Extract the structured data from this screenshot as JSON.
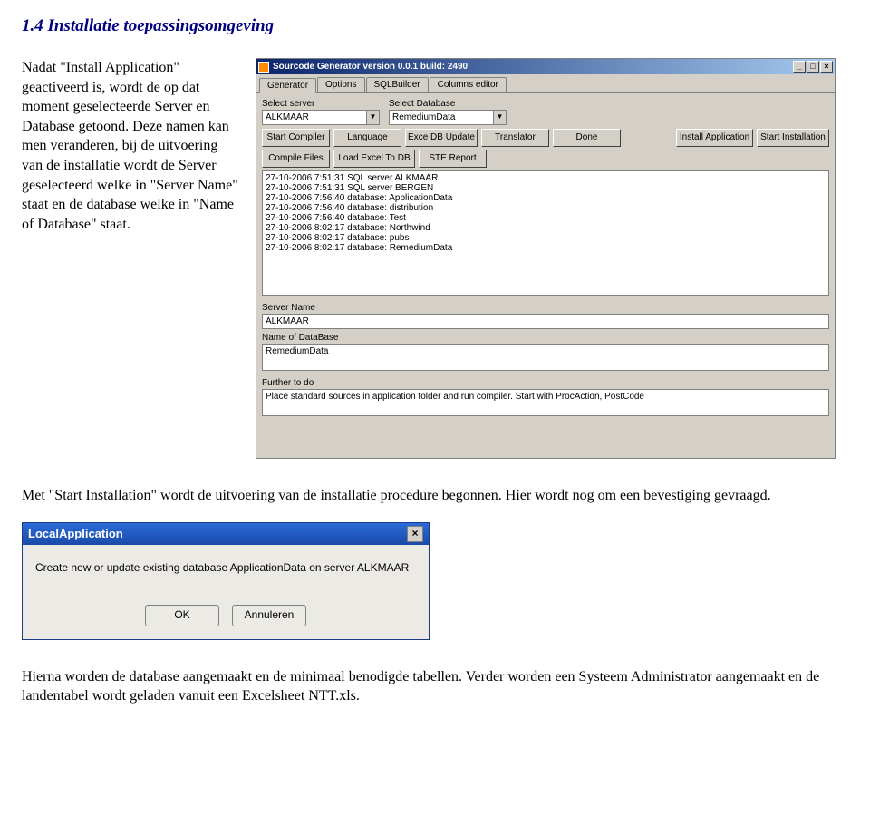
{
  "heading": "1.4   Installatie toepassingsomgeving",
  "intro": {
    "p1": "Nadat \"Install Application\" geactiveerd is, wordt de op dat moment geselecteerde Server en Database getoond. Deze namen kan men veranderen, bij de uitvoering van de installatie wordt de Server geselecteerd welke in \"Server Name\" staat en de database welke in \"Name of Database\" staat."
  },
  "app": {
    "title": "Sourcode Generator version 0.0.1 build: 2490",
    "winbtns": {
      "min": "_",
      "max": "□",
      "close": "×"
    },
    "tabs": [
      "Generator",
      "Options",
      "SQLBuilder",
      "Columns editor"
    ],
    "selectServerLabel": "Select server",
    "selectDbLabel": "Select Database",
    "serverCombo": "ALKMAAR",
    "dbCombo": "RemediumData",
    "buttonsRow1": [
      "Start Compiler",
      "Language",
      "Exce DB Update",
      "Translator",
      "Done"
    ],
    "buttonsRow1Right": [
      "Install Application",
      "Start Installation"
    ],
    "buttonsRow2": [
      "Compile Files",
      "Load Excel To DB",
      "STE Report"
    ],
    "log": [
      "27-10-2006 7:51:31 SQL server ALKMAAR",
      "27-10-2006 7:51:31 SQL server BERGEN",
      "27-10-2006 7:56:40 database: ApplicationData",
      "27-10-2006 7:56:40 database: distribution",
      "27-10-2006 7:56:40 database: Test",
      "27-10-2006 8:02:17 database: Northwind",
      "27-10-2006 8:02:17 database: pubs",
      "27-10-2006 8:02:17 database: RemediumData"
    ],
    "serverNameLabel": "Server Name",
    "serverNameValue": "ALKMAAR",
    "dbNameLabel": "Name of DataBase",
    "dbNameValue": "RemediumData",
    "furtherLabel": "Further to do",
    "furtherValue": "Place standard sources in application folder and run compiler. Start with ProcAction, PostCode"
  },
  "mid": "Met \"Start Installation\" wordt de uitvoering van de installatie procedure begonnen. Hier wordt nog om een bevestiging gevraagd.",
  "dialog": {
    "title": "LocalApplication",
    "close": "×",
    "message": "Create new or update existing database ApplicationData on server ALKMAAR",
    "ok": "OK",
    "cancel": "Annuleren"
  },
  "end": "Hierna worden de database aangemaakt en de minimaal benodigde tabellen. Verder worden een Systeem Administrator aangemaakt en de landentabel wordt geladen vanuit een Excelsheet NTT.xls."
}
